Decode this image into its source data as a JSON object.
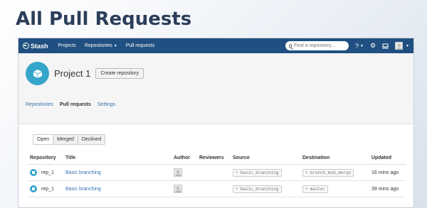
{
  "page_heading": "All Pull Requests",
  "topbar": {
    "brand": "Stash",
    "nav": [
      "Projects",
      "Repositories",
      "Pull requests"
    ],
    "search_placeholder": "Find a repository...",
    "help_icon": "?",
    "settings_icon": "gear-icon",
    "inbox_icon": "inbox-icon"
  },
  "project": {
    "title": "Project 1",
    "create_button": "Create repository",
    "tabs": [
      "Repositories",
      "Pull requests",
      "Settings"
    ],
    "active_tab": "Pull requests"
  },
  "filters": [
    "Open",
    "Merged",
    "Declined"
  ],
  "active_filter": "Open",
  "table": {
    "headers": [
      "Repository",
      "Title",
      "Author",
      "Reviewers",
      "Source",
      "Destination",
      "Updated"
    ],
    "rows": [
      {
        "repository": "rep_1",
        "title": "Basic branching",
        "source": "basic_branching",
        "destination": "branch_mod_merge",
        "updated": "16 mins ago"
      },
      {
        "repository": "rep_1",
        "title": "Basic branching",
        "source": "basic_branching",
        "destination": "master",
        "updated": "39 mins ago"
      }
    ]
  },
  "colors": {
    "topbar": "#205081",
    "link": "#3572b0",
    "accent": "#35a6c9"
  }
}
